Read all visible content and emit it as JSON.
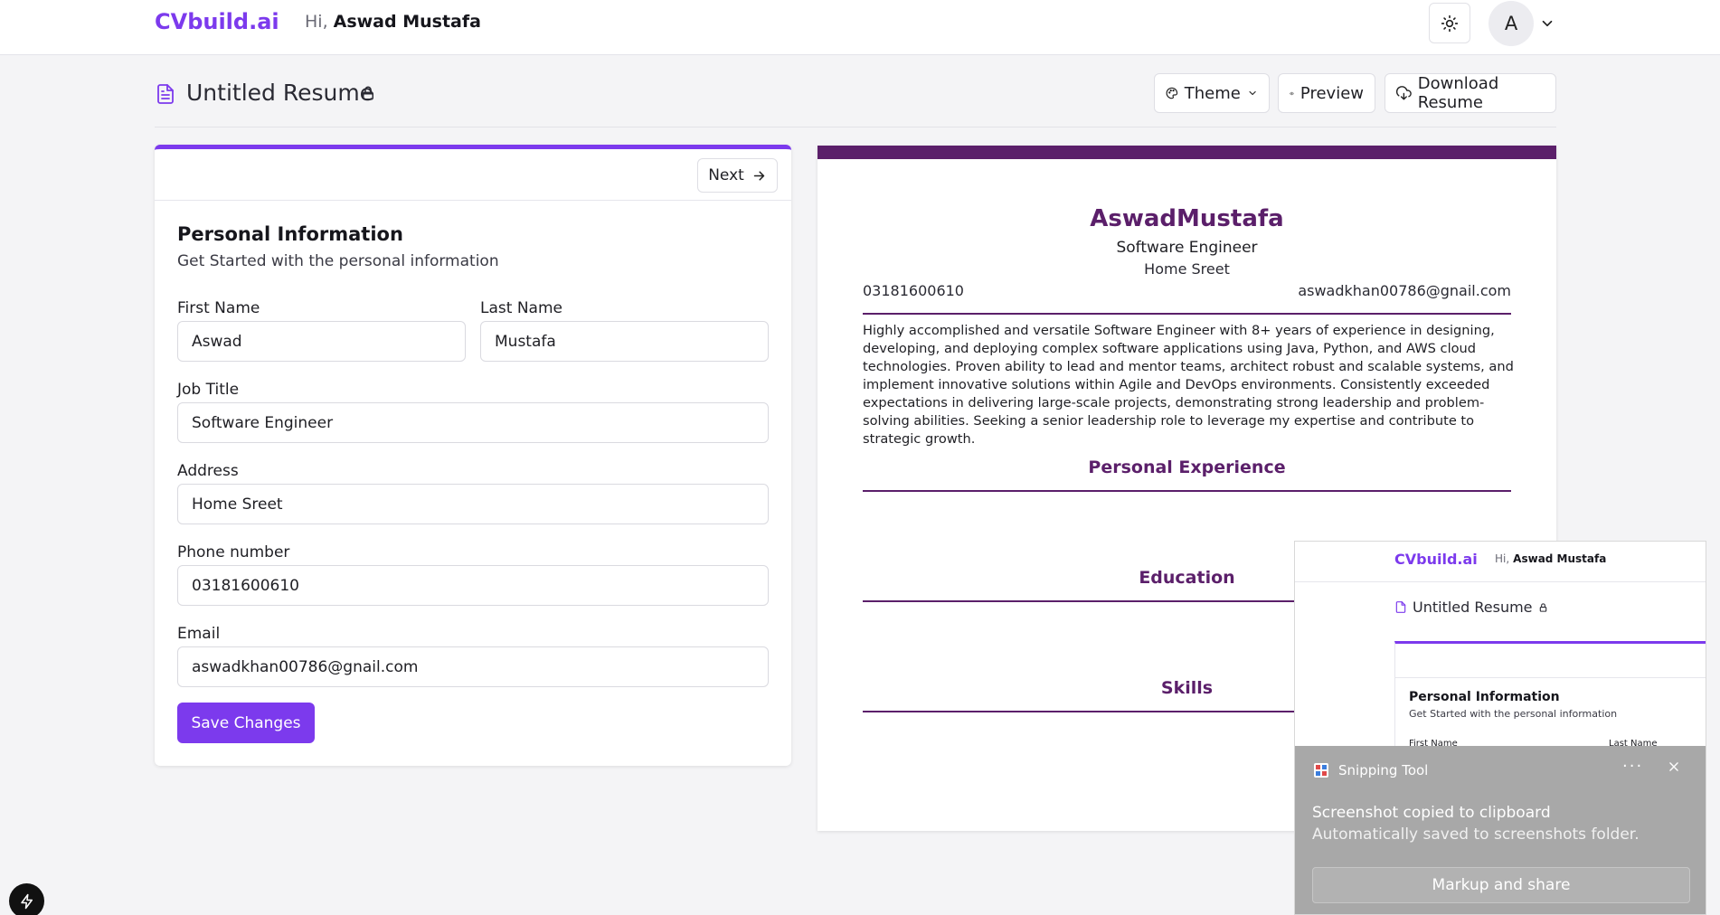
{
  "header": {
    "logo": "CVbuild.ai",
    "greeting": "Hi,",
    "user_name": "Aswad Mustafa",
    "avatar_initial": "A",
    "theme_toggle_icon": "sun-icon"
  },
  "toolbar": {
    "doc_title": "Untitled Resume",
    "theme_label": "Theme",
    "preview_label": "Preview",
    "download_label": "Download Resume"
  },
  "form": {
    "next_label": "Next",
    "section_title": "Personal Information",
    "section_subtitle": "Get Started with the personal information",
    "fields": {
      "first_name": {
        "label": "First Name",
        "value": "Aswad"
      },
      "last_name": {
        "label": "Last Name",
        "value": "Mustafa"
      },
      "job_title": {
        "label": "Job Title",
        "value": "Software Engineer"
      },
      "address": {
        "label": "Address",
        "value": "Home Sreet"
      },
      "phone": {
        "label": "Phone number",
        "value": "03181600610"
      },
      "email": {
        "label": "Email",
        "value": "aswadkhan00786@gnail.com"
      }
    },
    "save_label": "Save Changes"
  },
  "resume": {
    "accent_color": "#5b1f6a",
    "name": "AswadMustafa",
    "job_title": "Software Engineer",
    "address": "Home Sreet",
    "phone": "03181600610",
    "email": "aswadkhan00786@gnail.com",
    "summary": "Highly accomplished and versatile Software Engineer with 8+ years of experience in designing, developing, and deploying complex software applications using Java, Python, and AWS cloud technologies. Proven ability to lead and mentor teams, architect robust and scalable systems, and implement innovative solutions within Agile and DevOps environments. Consistently exceeded expectations in delivering large-scale projects, demonstrating strong leadership and problem-solving abilities. Seeking a senior leadership role to leverage my expertise and contribute to strategic growth.",
    "sections": {
      "experience": "Personal Experience",
      "education": "Education",
      "skills": "Skills"
    }
  },
  "snipping": {
    "app_name": "Snipping Tool",
    "more": "···",
    "message": "Screenshot copied to clipboard",
    "detail": "Automatically saved to screenshots folder.",
    "action_label": "Markup and share",
    "thumb": {
      "logo": "CVbuild.ai",
      "greeting": "Hi,",
      "user_name": "Aswad Mustafa",
      "doc_title": "Untitled Resume",
      "section_title": "Personal Information",
      "section_subtitle": "Get Started with the personal information",
      "first_label": "First Name",
      "last_label": "Last Name"
    }
  },
  "colors": {
    "brand": "#7c3aed"
  }
}
